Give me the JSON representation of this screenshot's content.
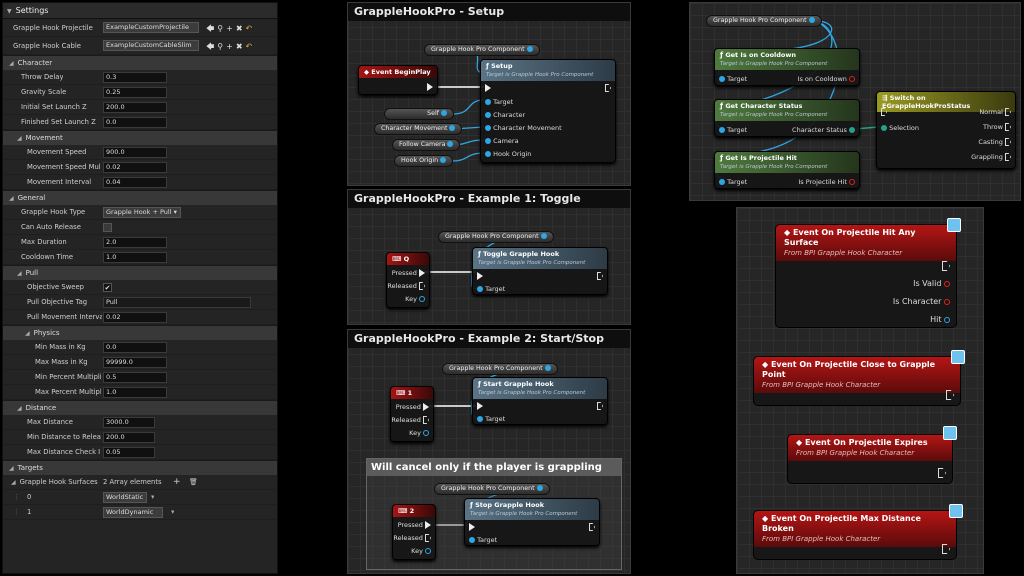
{
  "details": {
    "title": "Settings",
    "asset_rows": [
      {
        "label": "Grapple Hook Projectile",
        "value": "ExampleCustomProjectile"
      },
      {
        "label": "Grapple Hook Cable",
        "value": "ExampleCustomCableSlim"
      }
    ],
    "sections": {
      "character": "Character",
      "movement": "Movement",
      "general": "General",
      "pull": "Pull",
      "physics": "Physics",
      "distance": "Distance",
      "targets": "Targets"
    },
    "character": [
      {
        "label": "Throw Delay",
        "value": "0.3"
      },
      {
        "label": "Gravity Scale",
        "value": "0.25"
      },
      {
        "label": "Initial Set Launch Z",
        "value": "200.0"
      },
      {
        "label": "Finished Set Launch Z",
        "value": "0.0"
      }
    ],
    "movement": [
      {
        "label": "Movement Speed",
        "value": "900.0"
      },
      {
        "label": "Movement Speed Mul",
        "value": "0.02"
      },
      {
        "label": "Movement Interval",
        "value": "0.04"
      }
    ],
    "general": {
      "type_label": "Grapple Hook Type",
      "type_value": "Grapple Hook + Pull",
      "auto_release_label": "Can Auto Release",
      "max_duration_label": "Max Duration",
      "max_duration_value": "2.0",
      "cooldown_label": "Cooldown Time",
      "cooldown_value": "1.0"
    },
    "pull": {
      "objective_sweep_label": "Objective Sweep",
      "objective_tag_label": "Pull Objective Tag",
      "objective_tag_value": "Pull",
      "movement_interval_label": "Pull Movement Interva",
      "movement_interval_value": "0.02"
    },
    "physics": [
      {
        "label": "Min Mass in Kg",
        "value": "0.0"
      },
      {
        "label": "Max Mass in Kg",
        "value": "99999.0"
      },
      {
        "label": "Min Percent Multipli",
        "value": "0.5"
      },
      {
        "label": "Max Percent Multipli",
        "value": "1.0"
      }
    ],
    "distance": [
      {
        "label": "Max Distance",
        "value": "3000.0"
      },
      {
        "label": "Min Distance to Relea",
        "value": "200.0"
      },
      {
        "label": "Max Distance Check I",
        "value": "0.05"
      }
    ],
    "targets": {
      "surfaces_label": "Grapple Hook Surfaces",
      "surfaces_count": "2 Array elements",
      "items": [
        {
          "index": "0",
          "value": "WorldStatic"
        },
        {
          "index": "1",
          "value": "WorldDynamic"
        }
      ]
    }
  },
  "setup": {
    "title": "GrappleHookPro - Setup",
    "component": "Grapple Hook Pro Component",
    "event": "Event BeginPlay",
    "node_title": "Setup",
    "node_sub": "Target is Grapple Hook Pro Component",
    "pins": [
      "Target",
      "Character",
      "Character Movement",
      "Camera",
      "Hook Origin"
    ],
    "inputs": [
      "Self",
      "Character Movement",
      "Follow Camera",
      "Hook Origin"
    ]
  },
  "toggle": {
    "title": "GrappleHookPro - Example 1: Toggle",
    "component": "Grapple Hook Pro Component",
    "key": "Q",
    "node_title": "Toggle Grapple Hook",
    "node_sub": "Target is Grapple Hook Pro Component",
    "target": "Target",
    "outs": [
      "Pressed",
      "Released",
      "Key"
    ]
  },
  "startstop": {
    "title": "GrappleHookPro - Example 2: Start/Stop",
    "component": "Grapple Hook Pro Component",
    "key1": "1",
    "start_title": "Start Grapple Hook",
    "node_sub": "Target is Grapple Hook Pro Component",
    "target": "Target",
    "outs": [
      "Pressed",
      "Released",
      "Key"
    ],
    "note": "Will cancel only if the player is grappling",
    "component2": "Grapple Hook Pro Component",
    "key2": "2",
    "stop_title": "Stop Grapple Hook",
    "stop_sub": "Target is Grapple Hook Pro Component"
  },
  "status": {
    "component": "Grapple Hook Pro Component",
    "cooldown_title": "Get Is on Cooldown",
    "cooldown_out": "Is on Cooldown",
    "status_title": "Get Character Status",
    "status_out": "Character Status",
    "projhit_title": "Get Is Projectile Hit",
    "projhit_out": "Is Projectile Hit",
    "sub": "Target is Grapple Hook Pro Component",
    "target": "Target",
    "switch_title": "Switch on EGrappleHookProStatus",
    "selection": "Selection",
    "cases": [
      "Normal",
      "Throw",
      "Casting",
      "Grappling"
    ]
  },
  "events": {
    "from": "From BPI Grapple Hook Character",
    "hit_title": "Event On Projectile Hit Any Surface",
    "hit_outs": [
      "Is Valid",
      "Is Character",
      "Hit"
    ],
    "close_title": "Event On Projectile Close to Grapple Point",
    "expires_title": "Event On Projectile Expires",
    "maxdist_title": "Event On Projectile Max Distance Broken"
  }
}
